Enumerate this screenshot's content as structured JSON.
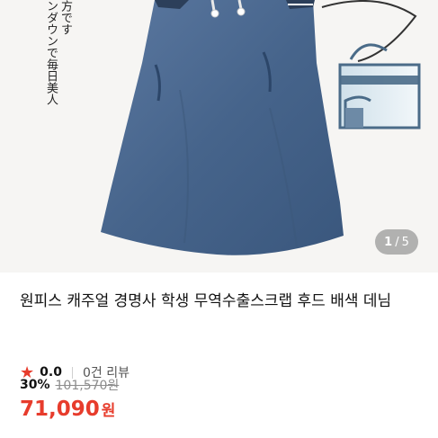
{
  "gallery": {
    "overlay_text": [
      "方です",
      "ンダウンで毎日美人"
    ],
    "counter": {
      "current": "1",
      "separator": "/",
      "total": "5"
    }
  },
  "product": {
    "title": "원피스 캐주얼 경명사 학생 무역수출스크랩 후드 배색 데님",
    "rating": {
      "icon": "star-icon",
      "score": "0.0",
      "reviews": "0건 리뷰"
    },
    "price": {
      "discount": "30%",
      "original": "101,570원",
      "final_number": "71,090",
      "final_unit": "원"
    }
  },
  "colors": {
    "accent": "#e73c2c",
    "denim": "#46648b"
  }
}
